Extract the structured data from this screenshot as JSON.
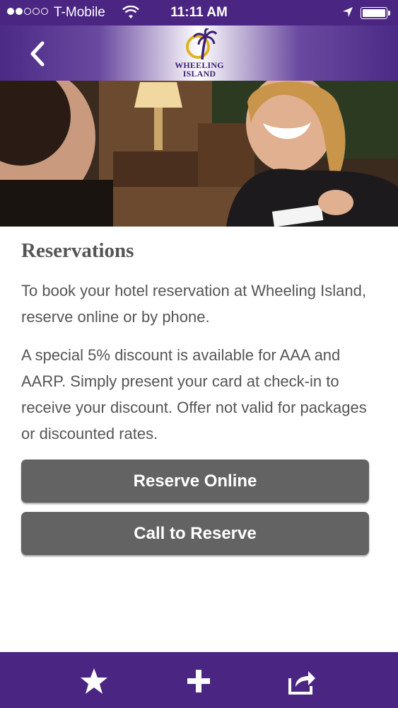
{
  "status_bar": {
    "carrier": "T-Mobile",
    "time": "11:11 AM"
  },
  "header": {
    "back_icon": "chevron-left-icon",
    "logo_line1": "WHEELING",
    "logo_line2": "ISLAND"
  },
  "hero": {
    "description_icon": "hotel-front-desk-photo"
  },
  "reservations": {
    "title": "Reservations",
    "paragraph1": "To book your hotel reservation at Wheeling Island, reserve online or by phone.",
    "paragraph2": "A special 5% discount is available for AAA and AARP. Simply present your card at check-in to receive your discount. Offer not valid for packages or discounted rates."
  },
  "buttons": {
    "reserve_online": "Reserve Online",
    "call_to_reserve": "Call to Reserve"
  },
  "toolbar": {
    "items": [
      "star-icon",
      "plus-icon",
      "share-icon"
    ]
  },
  "colors": {
    "brand_purple": "#4a2682",
    "button_gray": "#636363",
    "text_gray": "#555555"
  }
}
